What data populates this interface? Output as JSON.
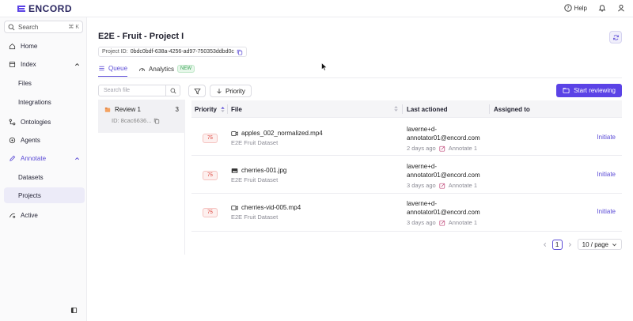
{
  "brand": {
    "name": "ENCORD"
  },
  "topbar": {
    "help_label": "Help"
  },
  "sidebar": {
    "search": {
      "placeholder": "Search",
      "shortcut": "⌘ K"
    },
    "items": [
      {
        "label": "Home"
      },
      {
        "label": "Index"
      },
      {
        "label": "Files"
      },
      {
        "label": "Integrations"
      },
      {
        "label": "Ontologies"
      },
      {
        "label": "Agents"
      },
      {
        "label": "Annotate"
      },
      {
        "label": "Datasets"
      },
      {
        "label": "Projects"
      },
      {
        "label": "Active"
      }
    ]
  },
  "project": {
    "title": "E2E - Fruit - Project I",
    "id_label": "Project ID:",
    "id_value": "0bdc0bdf-638a-4256-ad97-750353ddbd0c"
  },
  "tabs": [
    {
      "label": "Queue"
    },
    {
      "label": "Analytics",
      "badge": "NEW"
    }
  ],
  "queue": {
    "search_placeholder": "Search file",
    "priority_button": "Priority",
    "start_button": "Start reviewing",
    "stage": {
      "name": "Review 1",
      "count": "3",
      "id": "ID: 8cac6636..."
    },
    "columns": {
      "priority": "Priority",
      "file": "File",
      "last_actioned": "Last actioned",
      "assigned_to": "Assigned to"
    },
    "rows": [
      {
        "priority": "75",
        "file": "apples_002_normalized.mp4",
        "dataset": "E2E Fruit Dataset",
        "actor_line1": "laverne+d-",
        "actor_line2": "annotator01@encord.com",
        "when": "2 days ago",
        "stage": "Annotate 1",
        "action": "Initiate"
      },
      {
        "priority": "75",
        "file": "cherries-001.jpg",
        "dataset": "E2E Fruit Dataset",
        "actor_line1": "laverne+d-",
        "actor_line2": "annotator01@encord.com",
        "when": "3 days ago",
        "stage": "Annotate 1",
        "action": "Initiate"
      },
      {
        "priority": "75",
        "file": "cherries-vid-005.mp4",
        "dataset": "E2E Fruit Dataset",
        "actor_line1": "laverne+d-",
        "actor_line2": "annotator01@encord.com",
        "when": "3 days ago",
        "stage": "Annotate 1",
        "action": "Initiate"
      }
    ],
    "pagination": {
      "current": "1",
      "per_page": "10 / page"
    }
  },
  "colors": {
    "accent": "#5b43e6",
    "priority_red": "#d9352b"
  }
}
